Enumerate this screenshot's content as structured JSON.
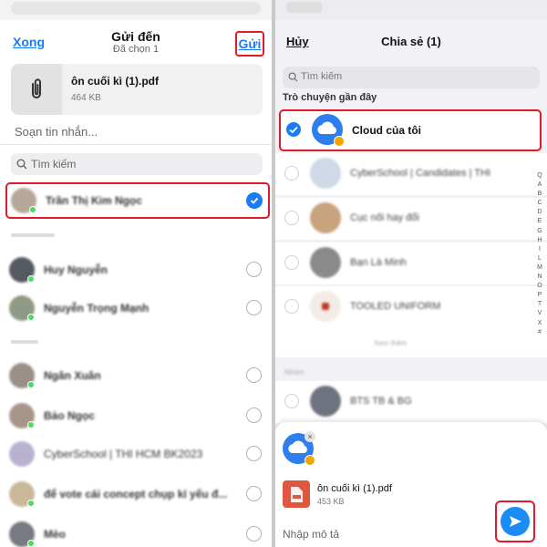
{
  "left": {
    "header": {
      "cancel_label": "Xong",
      "title": "Gửi đến",
      "subtitle": "Đã chọn 1",
      "send_label": "Gửi"
    },
    "attachment": {
      "file_name": "ôn cuối kì (1).pdf",
      "file_size": "464 KB"
    },
    "compose_placeholder": "Soạn tin nhắn...",
    "search_placeholder": "Tìm kiếm",
    "rows": [
      {
        "name": "Trần Thị Kim Ngọc",
        "selected": true
      },
      {
        "name": "Huy Nguyễn",
        "selected": false
      },
      {
        "name": "Nguyễn Trọng Mạnh",
        "selected": false
      },
      {
        "name": "Ngân Xuân",
        "selected": false
      },
      {
        "name": "Bảo Ngọc",
        "selected": false
      },
      {
        "name": "CyberSchool | THI HCM BK2023",
        "selected": false
      },
      {
        "name": "để vote cái concept chụp kỉ yếu đ...",
        "selected": false
      },
      {
        "name": "Mèo",
        "selected": false
      }
    ]
  },
  "right": {
    "header": {
      "cancel_label": "Hủy",
      "title": "Chia sẻ (1)"
    },
    "search_placeholder": "Tìm kiếm",
    "section_label": "Trò chuyện gần đây",
    "rows": [
      {
        "name": "Cloud của tôi",
        "selected": true
      },
      {
        "name": "CyberSchool | Candidates | THI",
        "selected": false
      },
      {
        "name": "Cục nối hay đổi",
        "selected": false
      },
      {
        "name": "Bạn Là Minh",
        "selected": false
      },
      {
        "name": "TOOLED UNIFORM",
        "selected": false
      }
    ],
    "see_all_label": "Xem thêm",
    "section2_label": "Nhóm",
    "group_row_name": "BTS TB & BG",
    "alphabet": [
      "Q",
      "A",
      "B",
      "C",
      "D",
      "E",
      "G",
      "H",
      "I",
      "L",
      "M",
      "N",
      "O",
      "P",
      "T",
      "V",
      "X",
      "#"
    ],
    "sheet": {
      "file_name": "ôn cuối kì (1).pdf",
      "file_size": "453 KB",
      "description_placeholder": "Nhập mô tả"
    }
  }
}
